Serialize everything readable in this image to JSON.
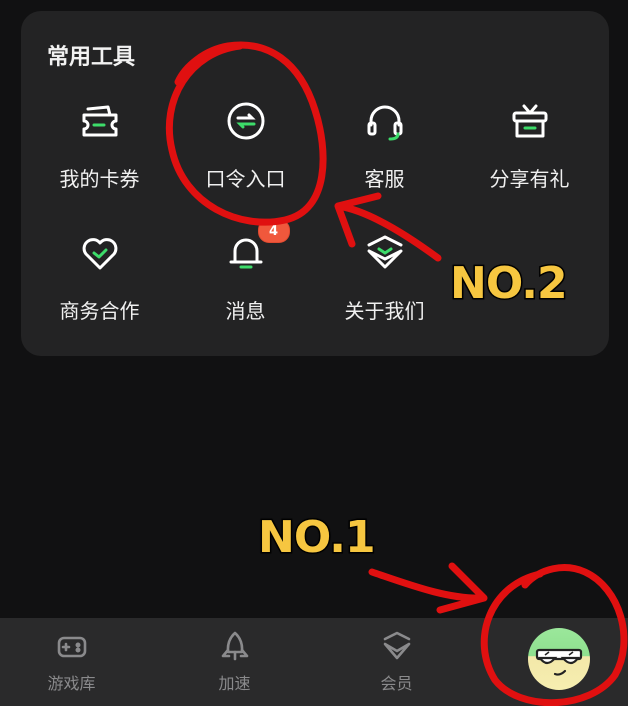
{
  "tools_card": {
    "title": "常用工具",
    "items": [
      {
        "label": "我的卡券",
        "icon": "ticket-icon"
      },
      {
        "label": "口令入口",
        "icon": "code-entry-icon"
      },
      {
        "label": "客服",
        "icon": "headset-icon"
      },
      {
        "label": "分享有礼",
        "icon": "gift-icon"
      },
      {
        "label": "商务合作",
        "icon": "heart-handshake-icon"
      },
      {
        "label": "消息",
        "icon": "bell-icon",
        "badge": "4"
      },
      {
        "label": "关于我们",
        "icon": "about-logo-icon"
      }
    ]
  },
  "tabbar": {
    "items": [
      {
        "label": "游戏库",
        "icon": "gamepad-icon"
      },
      {
        "label": "加速",
        "icon": "rocket-icon"
      },
      {
        "label": "会员",
        "icon": "vip-diamond-icon"
      },
      {
        "label": "",
        "icon": "avatar-sunglasses-icon"
      }
    ]
  },
  "annotations": {
    "label_1": "NO.1",
    "label_2": "NO.2"
  },
  "colors": {
    "background": "#111112",
    "card": "#232324",
    "accent_green": "#3ddc6a",
    "badge": "#f0583c",
    "annotation_red": "#e01010",
    "annotation_yellow": "#f6c640"
  }
}
